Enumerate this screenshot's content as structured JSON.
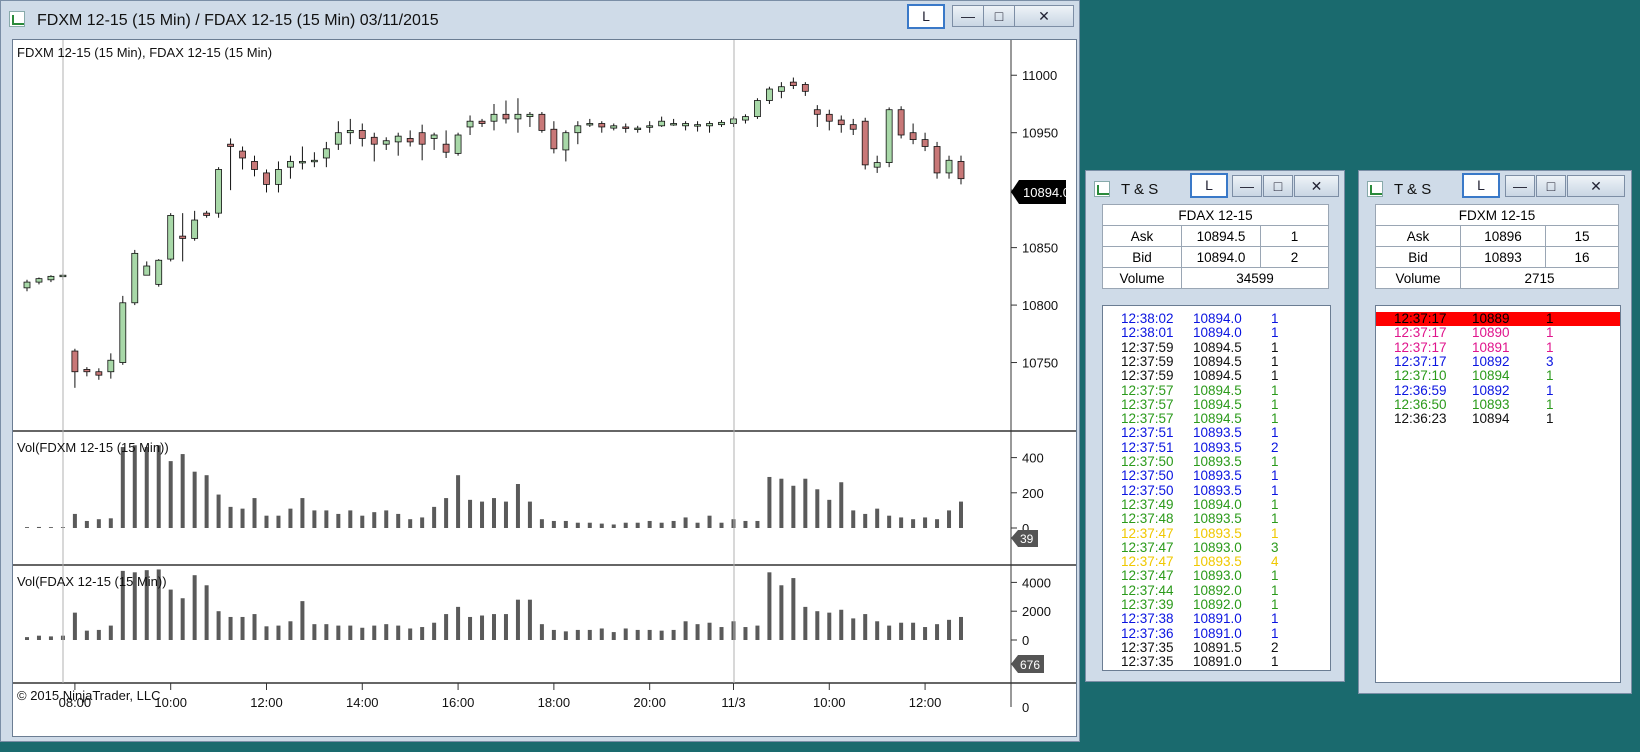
{
  "chart_window": {
    "title": "FDXM 12-15 (15 Min) / FDAX 12-15 (15 Min)  03/11/2015",
    "buttons": {
      "l": "L",
      "minimize": "—",
      "maximize": "□",
      "close": "✕"
    },
    "price_panel_label": "FDXM 12-15 (15 Min), FDAX 12-15 (15 Min)",
    "price_marker": "10894.0",
    "price_y_ticks": [
      "11000",
      "10950",
      "10900",
      "10850",
      "10800",
      "10750"
    ],
    "vol1_label": "Vol(FDXM 12-15 (15 Min))",
    "vol1_marker": "39",
    "vol1_y_ticks": [
      "400",
      "200",
      "0"
    ],
    "vol2_label": "Vol(FDAX 12-15 (15 Min))",
    "vol2_marker": "676",
    "vol2_y_ticks": [
      "4000",
      "2000",
      "0"
    ],
    "footer_zero": "0",
    "copyright": "© 2015 NinjaTrader, LLC",
    "x_ticks": [
      "08:00",
      "10:00",
      "12:00",
      "14:00",
      "16:00",
      "18:00",
      "20:00",
      "11/3",
      "10:00",
      "12:00"
    ],
    "colors": {
      "up": "#a8d8a8",
      "down": "#c87878",
      "vol": "#5a5a5a"
    }
  },
  "chart_data": [
    {
      "type": "candlestick",
      "title": "FDXM 12-15 (15 Min), FDAX 12-15 (15 Min)",
      "ylim": [
        10700,
        11015
      ],
      "x": [
        "07:00",
        "07:15",
        "07:30",
        "07:45",
        "08:00",
        "08:15",
        "08:30",
        "08:45",
        "09:00",
        "09:15",
        "09:30",
        "09:45",
        "10:00",
        "10:15",
        "10:30",
        "10:45",
        "11:00",
        "11:15",
        "11:30",
        "11:45",
        "12:00",
        "12:15",
        "12:30",
        "12:45",
        "13:00",
        "13:15",
        "13:30",
        "13:45",
        "14:00",
        "14:15",
        "14:30",
        "14:45",
        "15:00",
        "15:15",
        "15:30",
        "15:45",
        "16:00",
        "16:15",
        "16:30",
        "16:45",
        "17:00",
        "17:15",
        "17:30",
        "17:45",
        "18:00",
        "18:15",
        "18:30",
        "18:45",
        "19:00",
        "19:15",
        "19:30",
        "19:45",
        "20:00",
        "20:15",
        "20:30",
        "20:45",
        "21:00",
        "21:15",
        "21:30",
        "08:00",
        "08:15",
        "08:30",
        "08:45",
        "09:00",
        "09:15",
        "09:30",
        "09:45",
        "10:00",
        "10:15",
        "10:30",
        "10:45",
        "11:00",
        "11:15",
        "11:30",
        "11:45",
        "12:00",
        "12:15",
        "12:30",
        "12:45"
      ],
      "ohlc": [
        [
          10815,
          10822,
          10812,
          10820
        ],
        [
          10820,
          10824,
          10818,
          10823
        ],
        [
          10822,
          10826,
          10820,
          10825
        ],
        [
          10825,
          10828,
          10822,
          10826
        ],
        [
          10760,
          10762,
          10728,
          10742
        ],
        [
          10744,
          10746,
          10738,
          10742
        ],
        [
          10742,
          10745,
          10735,
          10739
        ],
        [
          10742,
          10758,
          10736,
          10752
        ],
        [
          10750,
          10808,
          10748,
          10802
        ],
        [
          10802,
          10848,
          10800,
          10845
        ],
        [
          10826,
          10838,
          10826,
          10834
        ],
        [
          10818,
          10840,
          10816,
          10839
        ],
        [
          10840,
          10880,
          10838,
          10878
        ],
        [
          10860,
          10880,
          10838,
          10858
        ],
        [
          10858,
          10882,
          10856,
          10874
        ],
        [
          10880,
          10882,
          10876,
          10878
        ],
        [
          10880,
          10920,
          10876,
          10918
        ],
        [
          10940,
          10945,
          10900,
          10938
        ],
        [
          10934,
          10938,
          10918,
          10928
        ],
        [
          10925,
          10930,
          10912,
          10918
        ],
        [
          10915,
          10918,
          10898,
          10905
        ],
        [
          10905,
          10925,
          10898,
          10918
        ],
        [
          10920,
          10930,
          10910,
          10925
        ],
        [
          10924,
          10938,
          10918,
          10925
        ],
        [
          10925,
          10933,
          10920,
          10926
        ],
        [
          10928,
          10942,
          10920,
          10936
        ],
        [
          10940,
          10960,
          10935,
          10950
        ],
        [
          10950,
          10962,
          10940,
          10952
        ],
        [
          10952,
          10958,
          10938,
          10945
        ],
        [
          10946,
          10950,
          10925,
          10940
        ],
        [
          10940,
          10946,
          10935,
          10943
        ],
        [
          10942,
          10950,
          10930,
          10947
        ],
        [
          10945,
          10952,
          10938,
          10942
        ],
        [
          10950,
          10957,
          10926,
          10940
        ],
        [
          10945,
          10950,
          10935,
          10948
        ],
        [
          10940,
          10952,
          10928,
          10933
        ],
        [
          10932,
          10950,
          10930,
          10948
        ],
        [
          10955,
          10965,
          10948,
          10960
        ],
        [
          10960,
          10962,
          10955,
          10958
        ],
        [
          10960,
          10975,
          10952,
          10966
        ],
        [
          10966,
          10978,
          10958,
          10962
        ],
        [
          10962,
          10980,
          10950,
          10966
        ],
        [
          10964,
          10968,
          10955,
          10966
        ],
        [
          10966,
          10968,
          10950,
          10952
        ],
        [
          10953,
          10960,
          10932,
          10936
        ],
        [
          10935,
          10952,
          10925,
          10950
        ],
        [
          10950,
          10960,
          10940,
          10956
        ],
        [
          10957,
          10962,
          10955,
          10958
        ],
        [
          10958,
          10960,
          10950,
          10955
        ],
        [
          10954,
          10958,
          10952,
          10956
        ],
        [
          10955,
          10958,
          10950,
          10954
        ],
        [
          10953,
          10956,
          10950,
          10954
        ],
        [
          10955,
          10960,
          10950,
          10956
        ],
        [
          10956,
          10964,
          10955,
          10960
        ],
        [
          10957,
          10962,
          10956,
          10958
        ],
        [
          10956,
          10960,
          10952,
          10958
        ],
        [
          10956,
          10960,
          10951,
          10957
        ],
        [
          10956,
          10960,
          10950,
          10958
        ],
        [
          10957,
          10961,
          10955,
          10959
        ],
        [
          10958,
          10964,
          10955,
          10962
        ],
        [
          10961,
          10966,
          10958,
          10964
        ],
        [
          10964,
          10980,
          10962,
          10978
        ],
        [
          10978,
          10990,
          10975,
          10988
        ],
        [
          10986,
          10994,
          10980,
          10990
        ],
        [
          10994,
          10998,
          10988,
          10991
        ],
        [
          10992,
          10994,
          10982,
          10986
        ],
        [
          10970,
          10974,
          10955,
          10966
        ],
        [
          10966,
          10970,
          10952,
          10960
        ],
        [
          10961,
          10965,
          10950,
          10957
        ],
        [
          10957,
          10962,
          10948,
          10953
        ],
        [
          10960,
          10963,
          10918,
          10922
        ],
        [
          10920,
          10930,
          10915,
          10924
        ],
        [
          10924,
          10972,
          10920,
          10970
        ],
        [
          10970,
          10973,
          10945,
          10948
        ],
        [
          10950,
          10958,
          10940,
          10944
        ],
        [
          10944,
          10950,
          10934,
          10938
        ],
        [
          10938,
          10942,
          10910,
          10915
        ],
        [
          10915,
          10930,
          10910,
          10926
        ],
        [
          10925,
          10930,
          10905,
          10910
        ]
      ]
    },
    {
      "type": "bar",
      "title": "Vol(FDXM 12-15 (15 Min))",
      "ylim": [
        0,
        500
      ],
      "values": [
        5,
        6,
        5,
        5,
        80,
        40,
        50,
        55,
        460,
        470,
        460,
        470,
        380,
        420,
        320,
        300,
        190,
        120,
        110,
        170,
        70,
        70,
        110,
        170,
        100,
        100,
        80,
        100,
        70,
        90,
        100,
        80,
        50,
        60,
        120,
        170,
        300,
        160,
        150,
        170,
        150,
        250,
        150,
        50,
        40,
        40,
        30,
        30,
        25,
        20,
        30,
        30,
        40,
        30,
        40,
        60,
        30,
        70,
        30,
        50,
        40,
        40,
        290,
        280,
        240,
        280,
        220,
        160,
        260,
        100,
        80,
        110,
        70,
        60,
        50,
        60,
        50,
        100,
        150,
        40
      ]
    },
    {
      "type": "bar",
      "title": "Vol(FDAX 12-15 (15 Min))",
      "ylim": [
        0,
        5000
      ],
      "values": [
        200,
        300,
        250,
        300,
        1900,
        650,
        700,
        1000,
        4800,
        4700,
        4850,
        4900,
        3500,
        2900,
        4500,
        3800,
        2000,
        1600,
        1600,
        1800,
        950,
        1000,
        1300,
        2700,
        1100,
        1100,
        1000,
        1000,
        850,
        1000,
        1100,
        1000,
        800,
        900,
        1200,
        1800,
        2300,
        1600,
        1700,
        1800,
        1800,
        2800,
        2800,
        1100,
        700,
        600,
        700,
        700,
        800,
        550,
        800,
        700,
        700,
        650,
        700,
        1300,
        1100,
        1200,
        900,
        1300,
        900,
        1000,
        4700,
        3800,
        4300,
        2300,
        2000,
        1900,
        2100,
        1500,
        1800,
        1300,
        1000,
        1200,
        1200,
        900,
        1100,
        1400,
        1600,
        1200
      ]
    }
  ],
  "ts_left": {
    "title": "T & S",
    "buttons": {
      "l": "L",
      "minimize": "—",
      "maximize": "□",
      "close": "✕"
    },
    "instrument": "FDAX 12-15",
    "ask_label": "Ask",
    "ask_price": "10894.5",
    "ask_size": "1",
    "bid_label": "Bid",
    "bid_price": "10894.0",
    "bid_size": "2",
    "volume_label": "Volume",
    "volume": "34599",
    "rows": [
      {
        "time": "12:38:02",
        "price": "10894.0",
        "size": "1",
        "color": "#0a14e0"
      },
      {
        "time": "12:38:01",
        "price": "10894.0",
        "size": "1",
        "color": "#0a14e0"
      },
      {
        "time": "12:37:59",
        "price": "10894.5",
        "size": "1",
        "color": "#111111"
      },
      {
        "time": "12:37:59",
        "price": "10894.5",
        "size": "1",
        "color": "#111111"
      },
      {
        "time": "12:37:59",
        "price": "10894.5",
        "size": "1",
        "color": "#111111"
      },
      {
        "time": "12:37:57",
        "price": "10894.5",
        "size": "1",
        "color": "#2a9a1a"
      },
      {
        "time": "12:37:57",
        "price": "10894.5",
        "size": "1",
        "color": "#2a9a1a"
      },
      {
        "time": "12:37:57",
        "price": "10894.5",
        "size": "1",
        "color": "#2a9a1a"
      },
      {
        "time": "12:37:51",
        "price": "10893.5",
        "size": "1",
        "color": "#0a14e0"
      },
      {
        "time": "12:37:51",
        "price": "10893.5",
        "size": "2",
        "color": "#0a14e0"
      },
      {
        "time": "12:37:50",
        "price": "10893.5",
        "size": "1",
        "color": "#2a9a1a"
      },
      {
        "time": "12:37:50",
        "price": "10893.5",
        "size": "1",
        "color": "#0a14e0"
      },
      {
        "time": "12:37:50",
        "price": "10893.5",
        "size": "1",
        "color": "#0a14e0"
      },
      {
        "time": "12:37:49",
        "price": "10894.0",
        "size": "1",
        "color": "#2a9a1a"
      },
      {
        "time": "12:37:48",
        "price": "10893.5",
        "size": "1",
        "color": "#2a9a1a"
      },
      {
        "time": "12:37:47",
        "price": "10893.5",
        "size": "1",
        "color": "#f0c800"
      },
      {
        "time": "12:37:47",
        "price": "10893.0",
        "size": "3",
        "color": "#2a9a1a"
      },
      {
        "time": "12:37:47",
        "price": "10893.5",
        "size": "4",
        "color": "#f0c800"
      },
      {
        "time": "12:37:47",
        "price": "10893.0",
        "size": "1",
        "color": "#2a9a1a"
      },
      {
        "time": "12:37:44",
        "price": "10892.0",
        "size": "1",
        "color": "#2a9a1a"
      },
      {
        "time": "12:37:39",
        "price": "10892.0",
        "size": "1",
        "color": "#2a9a1a"
      },
      {
        "time": "12:37:38",
        "price": "10891.0",
        "size": "1",
        "color": "#0a14e0"
      },
      {
        "time": "12:37:36",
        "price": "10891.0",
        "size": "1",
        "color": "#0a14e0"
      },
      {
        "time": "12:37:35",
        "price": "10891.5",
        "size": "2",
        "color": "#111111"
      },
      {
        "time": "12:37:35",
        "price": "10891.0",
        "size": "1",
        "color": "#111111"
      }
    ]
  },
  "ts_right": {
    "title": "T & S",
    "buttons": {
      "l": "L",
      "minimize": "—",
      "maximize": "□",
      "close": "✕"
    },
    "instrument": "FDXM 12-15",
    "ask_label": "Ask",
    "ask_price": "10896",
    "ask_size": "15",
    "bid_label": "Bid",
    "bid_price": "10893",
    "bid_size": "16",
    "volume_label": "Volume",
    "volume": "2715",
    "rows": [
      {
        "time": "12:37:17",
        "price": "10889",
        "size": "1",
        "color": "#000000",
        "bg": "#ff0000"
      },
      {
        "time": "12:37:17",
        "price": "10890",
        "size": "1",
        "color": "#e0148c"
      },
      {
        "time": "12:37:17",
        "price": "10891",
        "size": "1",
        "color": "#e0148c"
      },
      {
        "time": "12:37:17",
        "price": "10892",
        "size": "3",
        "color": "#0a14e0"
      },
      {
        "time": "12:37:10",
        "price": "10894",
        "size": "1",
        "color": "#2a9a1a"
      },
      {
        "time": "12:36:59",
        "price": "10892",
        "size": "1",
        "color": "#0a14e0"
      },
      {
        "time": "12:36:50",
        "price": "10893",
        "size": "1",
        "color": "#2a9a1a"
      },
      {
        "time": "12:36:23",
        "price": "10894",
        "size": "1",
        "color": "#111111"
      }
    ]
  }
}
